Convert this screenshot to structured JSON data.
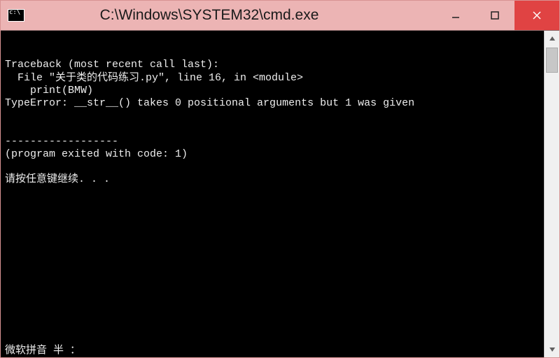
{
  "window": {
    "title": "C:\\Windows\\SYSTEM32\\cmd.exe",
    "sysicon_label": "c:\\"
  },
  "buttons": {
    "minimize": "—",
    "maximize": "☐",
    "close": "✕"
  },
  "console_lines": [
    "Traceback (most recent call last):",
    "  File \"关于类的代码练习.py\", line 16, in <module>",
    "    print(BMW)",
    "TypeError: __str__() takes 0 positional arguments but 1 was given",
    "",
    "",
    "------------------",
    "(program exited with code: 1)",
    "",
    "请按任意键继续. . ."
  ],
  "ime_status": "微软拼音 半 ："
}
